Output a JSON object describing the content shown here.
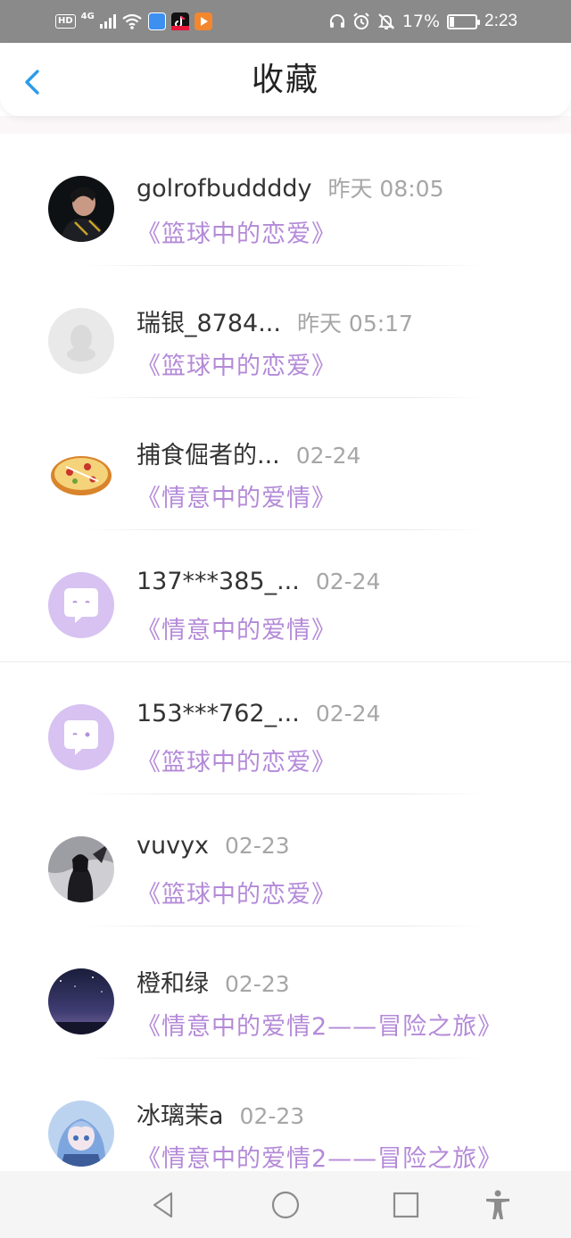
{
  "status_bar": {
    "network_badge": "HD",
    "network_type": "4G",
    "battery_percent": "17%",
    "battery_level": 0.17,
    "time": "2:23",
    "icons": [
      "hd-icon",
      "signal-icon",
      "wifi-icon",
      "app-store-icon",
      "tiktok-icon",
      "video-app-icon",
      "headphones-icon",
      "alarm-icon",
      "mute-bell-icon",
      "battery-icon"
    ]
  },
  "header": {
    "title": "收藏",
    "back_icon": "chevron-left-icon"
  },
  "items": [
    {
      "name": "golrofbuddddy",
      "time": "昨天 08:05",
      "book": "《篮球中的恋爱》",
      "avatar": "photo-dark"
    },
    {
      "name": "瑞银_8784...",
      "time": "昨天 05:17",
      "book": "《篮球中的恋爱》",
      "avatar": "default-penguin"
    },
    {
      "name": "捕食倔者的...",
      "time": "02-24",
      "book": "《情意中的爱情》",
      "avatar": "pizza"
    },
    {
      "name": "137***385_...",
      "time": "02-24",
      "book": "《情意中的爱情》",
      "avatar": "chat-bubble"
    },
    {
      "name": "153***762_...",
      "time": "02-24",
      "book": "《篮球中的恋爱》",
      "avatar": "chat-bubble"
    },
    {
      "name": "vuvyx",
      "time": "02-23",
      "book": "《篮球中的恋爱》",
      "avatar": "anime-dark"
    },
    {
      "name": "橙和绿",
      "time": "02-23",
      "book": "《情意中的爱情2——冒险之旅》",
      "avatar": "night-sky"
    },
    {
      "name": "冰璃茉a",
      "time": "02-23",
      "book": "《情意中的爱情2——冒险之旅》",
      "avatar": "anime-blue"
    }
  ],
  "nav": {
    "icons": [
      "back-triangle-icon",
      "home-circle-icon",
      "recents-square-icon",
      "accessibility-icon"
    ]
  },
  "colors": {
    "accent_purple": "#b48ad8",
    "back_blue": "#2b9bea",
    "status_bar": "#8a8a8a"
  }
}
